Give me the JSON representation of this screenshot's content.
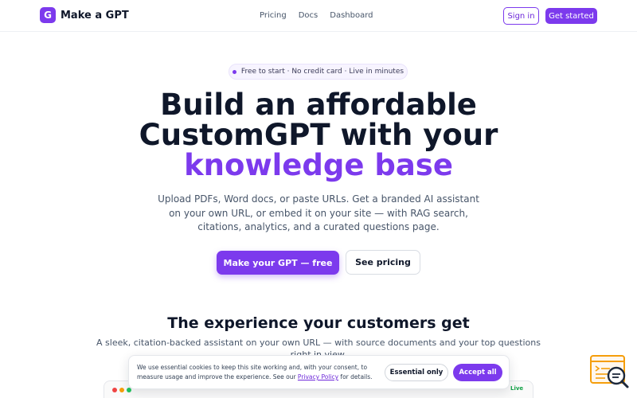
{
  "header": {
    "logo_letter": "G",
    "brand": "Make a GPT",
    "nav": [
      "Pricing",
      "Docs",
      "Dashboard"
    ],
    "signin_label": "Sign in",
    "get_started_label": "Get started"
  },
  "hero": {
    "badge": "Free to start · No credit card · Live in minutes",
    "title_line1": "Build an affordable",
    "title_line2": "CustomGPT with your",
    "title_accent": "knowledge base",
    "subtitle": "Upload PDFs, Word docs, or paste URLs. Get a branded AI assistant on your own URL, or embed it on your site — with RAG search, citations, analytics, and a curated questions page.",
    "primary_cta": "Make your GPT — free",
    "secondary_cta": "See pricing"
  },
  "section": {
    "title": "The experience your customers get",
    "subtitle": "A sleek, citation-backed assistant on your own URL — with source documents and your top questions right in view."
  },
  "preview": {
    "live_label": "Live"
  },
  "cookie": {
    "text_before": "We use essential cookies to keep this site working and, with your consent, to measure usage and improve the experience. See our ",
    "policy_link": "Privacy Policy",
    "text_after": " for details.",
    "essential_label": "Essential only",
    "accept_label": "Accept all"
  },
  "colors": {
    "accent": "#7c3aed",
    "text": "#0f172a",
    "muted": "#475569",
    "widget": "#f59e0b"
  },
  "icons": [
    "logo-mark",
    "status-dot-icon",
    "chat-search-widget-icon"
  ]
}
